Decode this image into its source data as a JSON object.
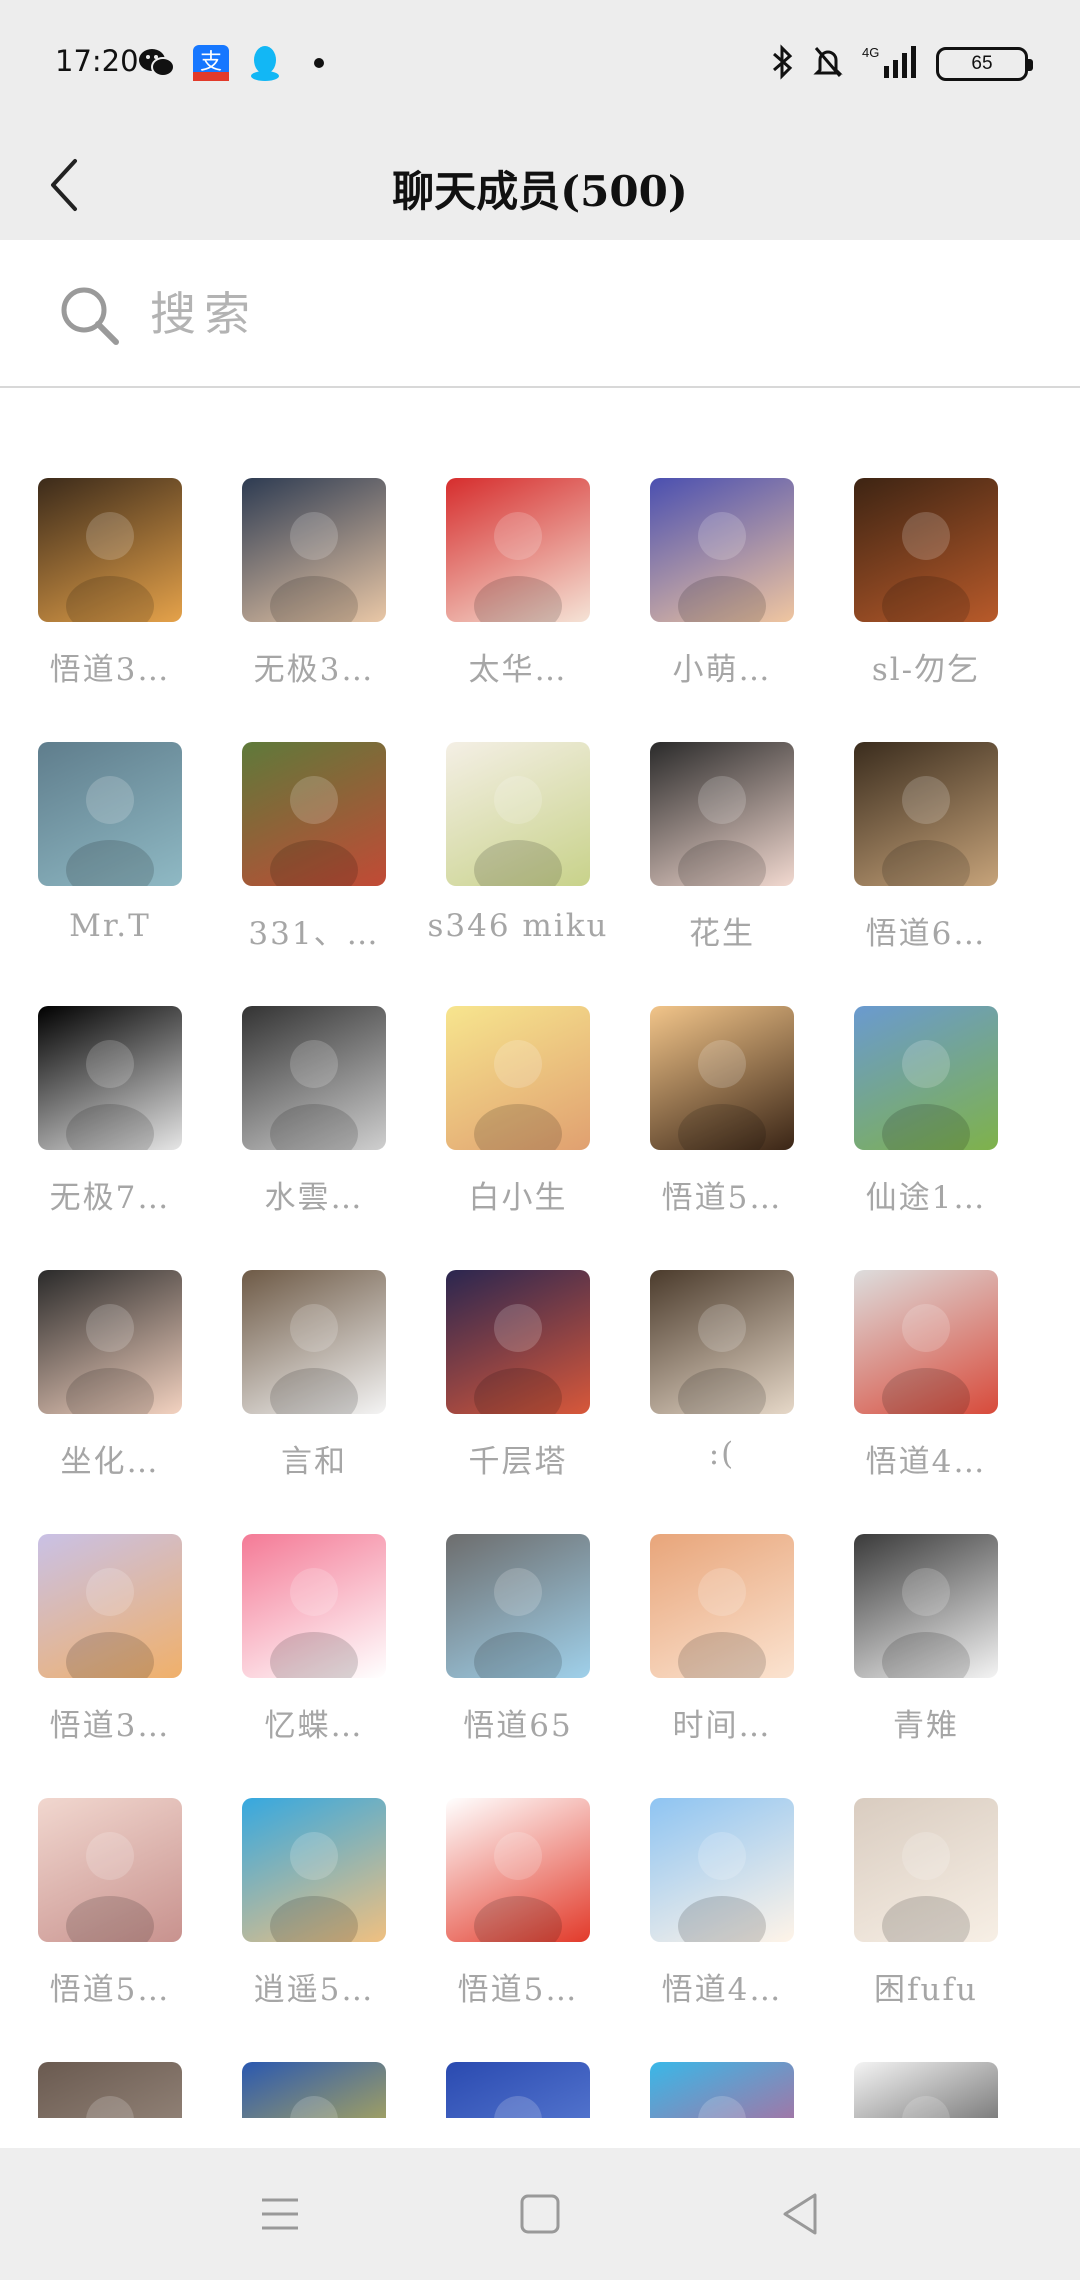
{
  "status": {
    "time": "17:20",
    "apps": [
      "wechat-icon",
      "alipay-icon",
      "qq-icon",
      "dot-icon"
    ],
    "network": "4G",
    "battery": "65"
  },
  "header": {
    "title": "聊天成员(500)"
  },
  "search": {
    "placeholder": "搜索",
    "value": ""
  },
  "members": [
    {
      "name": "悟道3…",
      "colors": [
        "#3b2a1a",
        "#e5a24a"
      ]
    },
    {
      "name": "无极3…",
      "colors": [
        "#2d3b52",
        "#e9c7a6"
      ]
    },
    {
      "name": "太华…",
      "colors": [
        "#d62d2d",
        "#f5e3d6"
      ]
    },
    {
      "name": "小萌…",
      "colors": [
        "#4a4fb0",
        "#f0c6a0"
      ]
    },
    {
      "name": "sl-勿乞",
      "colors": [
        "#3d2413",
        "#b85a2a"
      ]
    },
    {
      "name": "Mr.T",
      "colors": [
        "#5f7d8c",
        "#8fb9c4"
      ]
    },
    {
      "name": "331、…",
      "colors": [
        "#5e7a3a",
        "#c24a36"
      ]
    },
    {
      "name": "s346 miku",
      "colors": [
        "#f4efe5",
        "#c8d28a"
      ]
    },
    {
      "name": "花生",
      "colors": [
        "#2a2a2a",
        "#f2d9d0"
      ]
    },
    {
      "name": "悟道6…",
      "colors": [
        "#3a2c1d",
        "#c6a37a"
      ]
    },
    {
      "name": "无极7…",
      "colors": [
        "#000000",
        "#e6e6e6"
      ]
    },
    {
      "name": "水雲…",
      "colors": [
        "#333333",
        "#cfcfcf"
      ]
    },
    {
      "name": "白小生",
      "colors": [
        "#f7e58e",
        "#e0a070"
      ]
    },
    {
      "name": "悟道5…",
      "colors": [
        "#f2c58a",
        "#3a2516"
      ]
    },
    {
      "name": "仙途1…",
      "colors": [
        "#6a9ad0",
        "#7fb24a"
      ]
    },
    {
      "name": "坐化…",
      "colors": [
        "#2a2a2a",
        "#f3d2c0"
      ]
    },
    {
      "name": "言和",
      "colors": [
        "#6e5a46",
        "#f4f4f4"
      ]
    },
    {
      "name": "千层塔",
      "colors": [
        "#2a2650",
        "#d8583a"
      ]
    },
    {
      "name": ":(",
      "colors": [
        "#4b3b2c",
        "#e6d8c8"
      ]
    },
    {
      "name": "悟道4…",
      "colors": [
        "#dddddd",
        "#d84a3a"
      ]
    },
    {
      "name": "悟道3…",
      "colors": [
        "#c9c1e6",
        "#f0b06a"
      ]
    },
    {
      "name": "忆蝶…",
      "colors": [
        "#f47a96",
        "#ffffff"
      ]
    },
    {
      "name": "悟道65",
      "colors": [
        "#6d6d6d",
        "#9fd0ea"
      ]
    },
    {
      "name": "时间…",
      "colors": [
        "#e8a57a",
        "#fbe3d0"
      ]
    },
    {
      "name": "青雉",
      "colors": [
        "#3a3a3a",
        "#f4f4f4"
      ]
    },
    {
      "name": "悟道5…",
      "colors": [
        "#f1d7cf",
        "#c8928e"
      ]
    },
    {
      "name": "逍遥5…",
      "colors": [
        "#35a8e0",
        "#f0c080"
      ]
    },
    {
      "name": "悟道5…",
      "colors": [
        "#ffffff",
        "#e23a2a"
      ]
    },
    {
      "name": "悟道4…",
      "colors": [
        "#8ec4f2",
        "#fff4e8"
      ]
    },
    {
      "name": "困fufu",
      "colors": [
        "#d9ccc0",
        "#f7efe5"
      ]
    },
    {
      "name": "",
      "colors": [
        "#6a5a50",
        "#a99a8e"
      ]
    },
    {
      "name": "",
      "colors": [
        "#2a58b0",
        "#f0d030"
      ]
    },
    {
      "name": "",
      "colors": [
        "#2a4ab0",
        "#6c8ee0"
      ]
    },
    {
      "name": "",
      "colors": [
        "#39b8e8",
        "#e84a7a"
      ]
    },
    {
      "name": "",
      "colors": [
        "#f4f4f4",
        "#2a2a2a"
      ]
    }
  ],
  "nav": {
    "buttons": [
      "menu-icon",
      "home-icon",
      "back-triangle-icon"
    ]
  }
}
